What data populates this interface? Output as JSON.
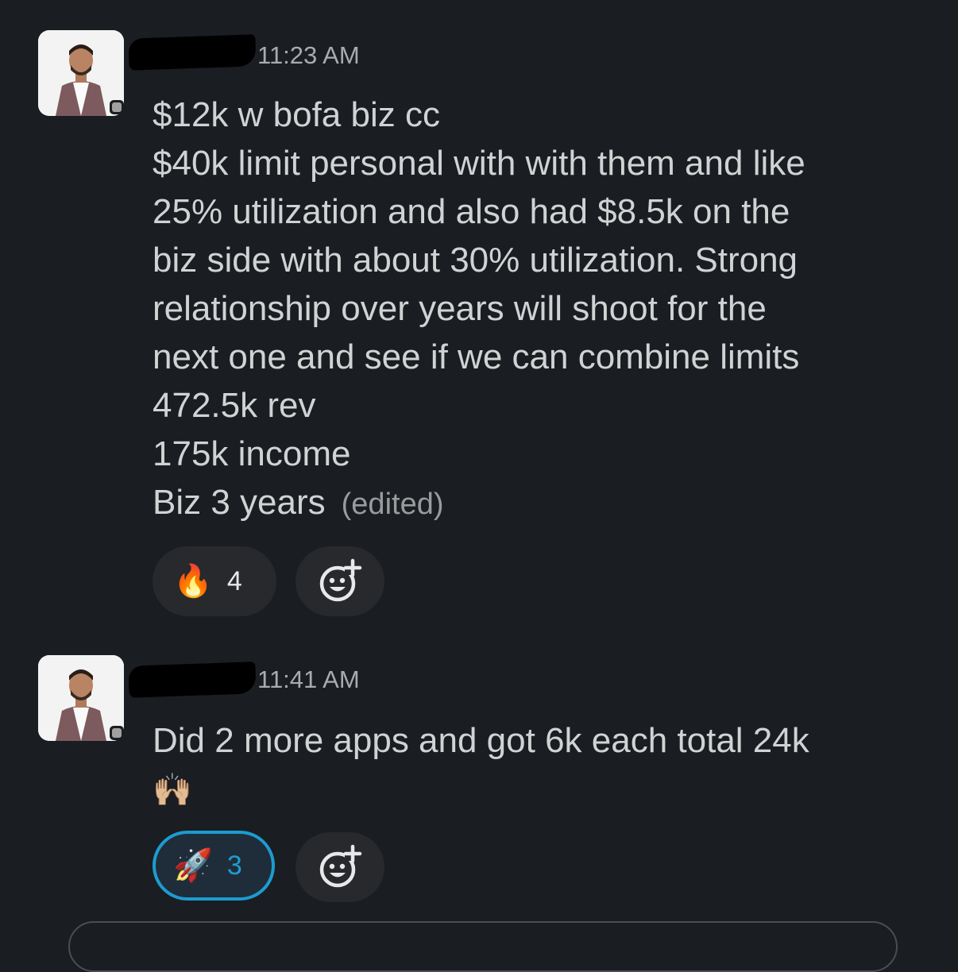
{
  "messages": [
    {
      "timestamp": "11:23 AM",
      "lines": [
        "$12k w bofa biz cc",
        "$40k limit personal with with them and like",
        "25% utilization and also had $8.5k on the",
        "biz side with about 30% utilization. Strong",
        "relationship over years will shoot for the",
        "next one and see if we can combine limits",
        "472.5k rev",
        "175k income",
        "Biz 3 years"
      ],
      "edited_label": "(edited)",
      "reaction": {
        "emoji": "🔥",
        "icon": "fire-icon",
        "count": "4"
      }
    },
    {
      "timestamp": "11:41 AM",
      "lines": [
        "Did 2 more apps and got 6k each total 24k",
        "🙌🏼"
      ],
      "reaction": {
        "emoji": "🚀",
        "icon": "rocket-icon",
        "count": "3",
        "selected": true
      }
    }
  ],
  "colors": {
    "background": "#1a1d21",
    "text": "#d1d2d3",
    "timestamp": "#ababad",
    "reaction_bg": "#27292d",
    "selected_border": "#1d9bd1"
  }
}
